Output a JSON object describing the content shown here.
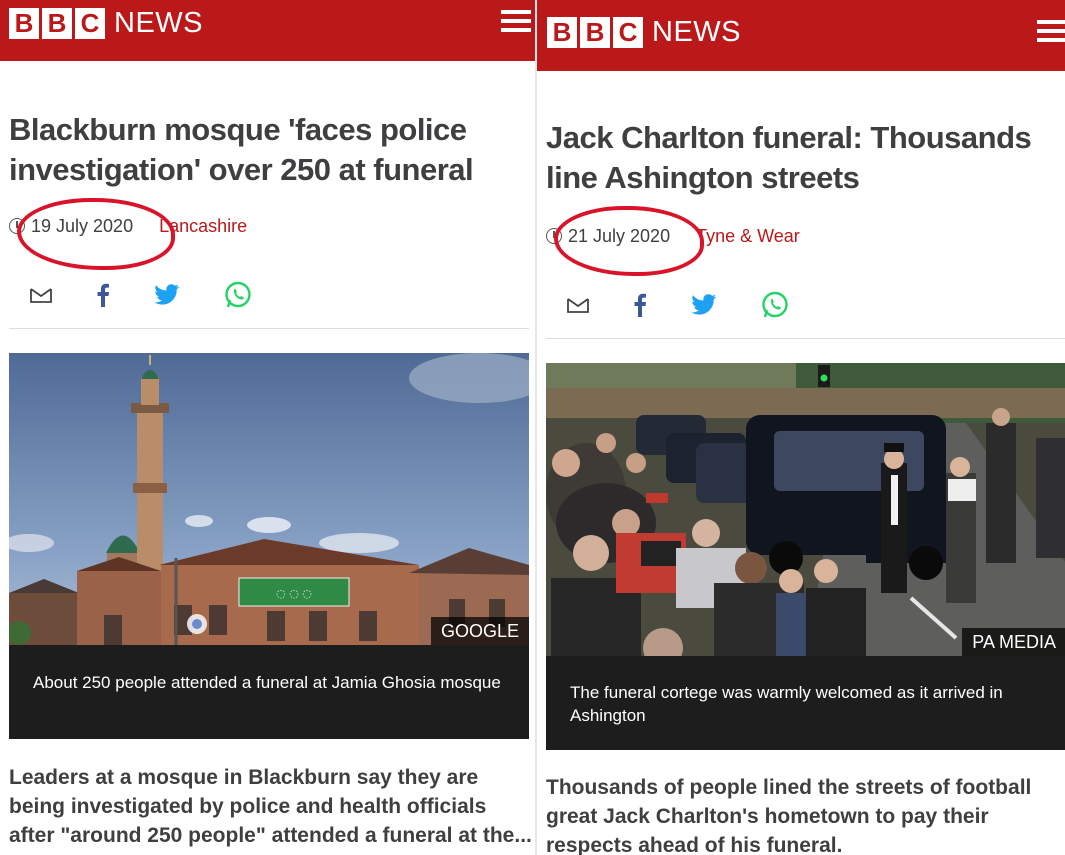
{
  "left": {
    "logo_letters": [
      "B",
      "B",
      "C"
    ],
    "logo_news": "NEWS",
    "headline": "Blackburn mosque 'faces police investigation' over 250 at funeral",
    "date": "19 July 2020",
    "region": "Lancashire",
    "image_credit": "GOOGLE",
    "caption": "About 250 people attended a funeral at Jamia Ghosia mosque",
    "body": "Leaders at a mosque in Blackburn say they are being investigated by police and health officials after \"around 250 people\" attended a funeral at the..."
  },
  "right": {
    "logo_letters": [
      "B",
      "B",
      "C"
    ],
    "logo_news": "NEWS",
    "headline": "Jack Charlton funeral: Thousands line Ashington streets",
    "date": "21 July 2020",
    "region": "Tyne & Wear",
    "image_credit": "PA MEDIA",
    "caption": "The funeral cortege was warmly welcomed as it arrived in Ashington",
    "body": "Thousands of people lined the streets of football great Jack Charlton's hometown to pay their respects ahead of his funeral."
  },
  "icons": [
    "clock-icon",
    "email-icon",
    "facebook-icon",
    "twitter-icon",
    "whatsapp-icon",
    "menu-icon"
  ],
  "colors": {
    "brand_red": "#bb1919",
    "annotation_red": "#d9142a",
    "caption_bg": "#1d1d1d",
    "facebook": "#3b5998",
    "twitter": "#1da1f2",
    "whatsapp": "#25d366"
  }
}
